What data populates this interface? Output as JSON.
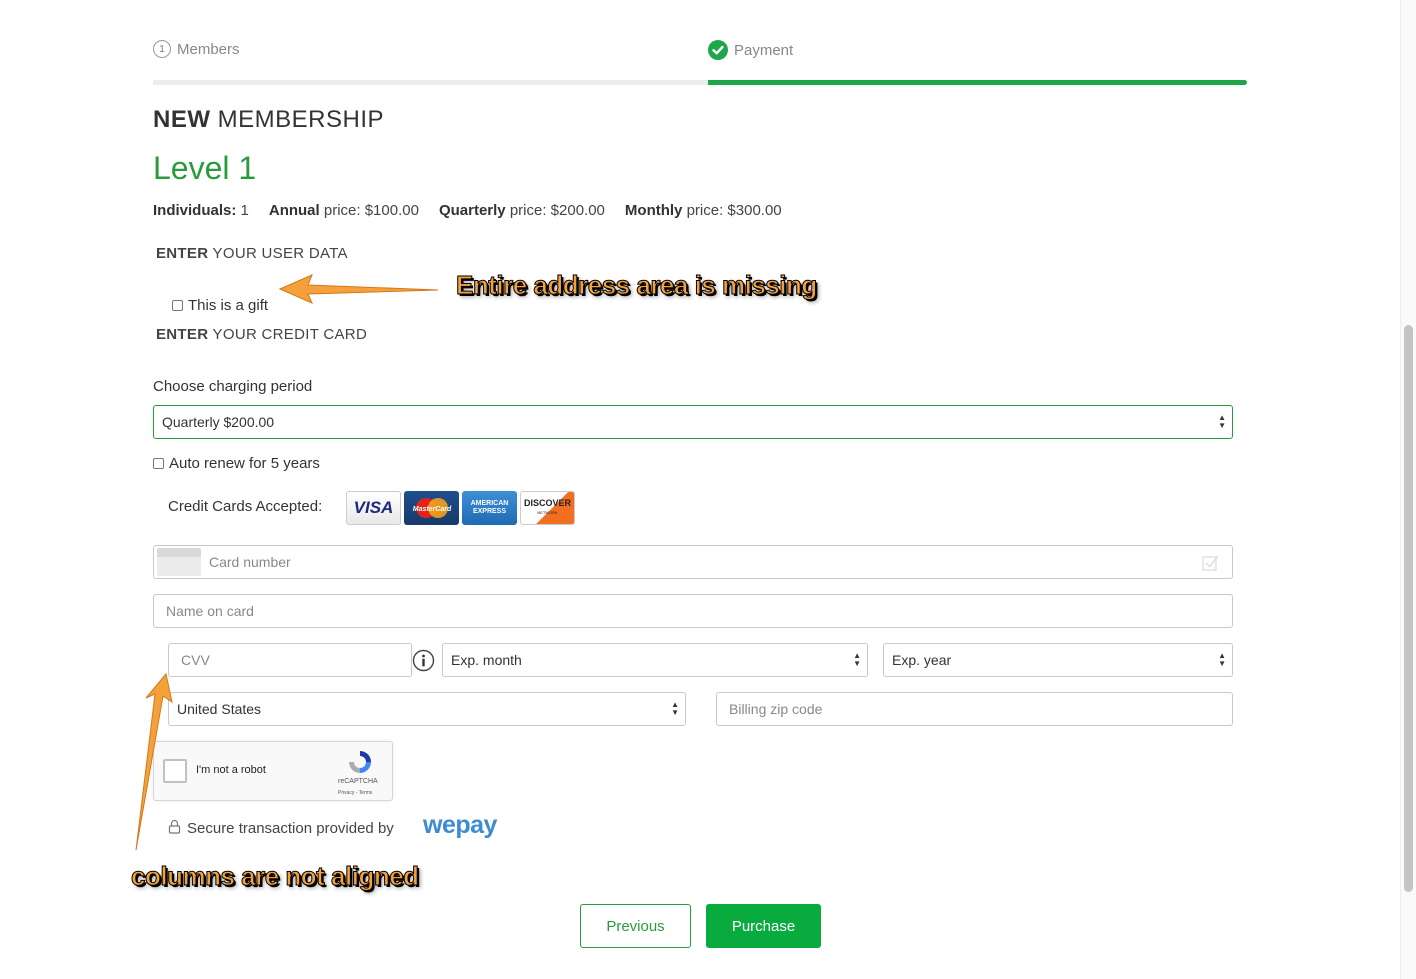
{
  "steps": [
    {
      "number": "1",
      "label": "Members"
    },
    {
      "label": "Payment"
    }
  ],
  "membership": {
    "title_bold": "NEW",
    "title_rest": " MEMBERSHIP",
    "level": "Level 1",
    "individuals_label": "Individuals:",
    "individuals_value": " 1",
    "annual_label": "Annual",
    "annual_price": " price: $100.00",
    "quarterly_label": "Quarterly",
    "quarterly_price": " price: $200.00",
    "monthly_label": "Monthly",
    "monthly_price": " price: $300.00"
  },
  "user_data": {
    "head_bold": "ENTER",
    "head_rest": " YOUR USER DATA",
    "gift_label": "This is a gift"
  },
  "credit_card": {
    "head_bold": "ENTER",
    "head_rest": " YOUR CREDIT CARD"
  },
  "charging": {
    "label": "Choose charging period",
    "selected": "Quarterly $200.00",
    "auto_renew": "Auto renew for 5 years"
  },
  "cards_accepted": {
    "label": "Credit Cards Accepted:",
    "logos": [
      "VISA",
      "MasterCard",
      "AMERICAN EXPRESS",
      "DISCOVER"
    ],
    "discover_sub": "NETWORK"
  },
  "form": {
    "card_number_placeholder": "Card number",
    "name_placeholder": "Name on card",
    "cvv_placeholder": "CVV",
    "exp_month": "Exp. month",
    "exp_year": "Exp. year",
    "country": "United States",
    "zip_placeholder": "Billing zip code"
  },
  "recaptcha": {
    "label": "I'm not a robot",
    "brand": "reCAPTCHA",
    "links": "Privacy - Terms"
  },
  "secure": {
    "text": "Secure transaction provided by",
    "brand": "wepay"
  },
  "buttons": {
    "previous": "Previous",
    "purchase": "Purchase"
  },
  "annotations": {
    "address_missing": "Entire address area is missing",
    "columns": "columns are not aligned"
  },
  "colors": {
    "accent": "#1fa64a",
    "annotation": "#f5a13b"
  }
}
